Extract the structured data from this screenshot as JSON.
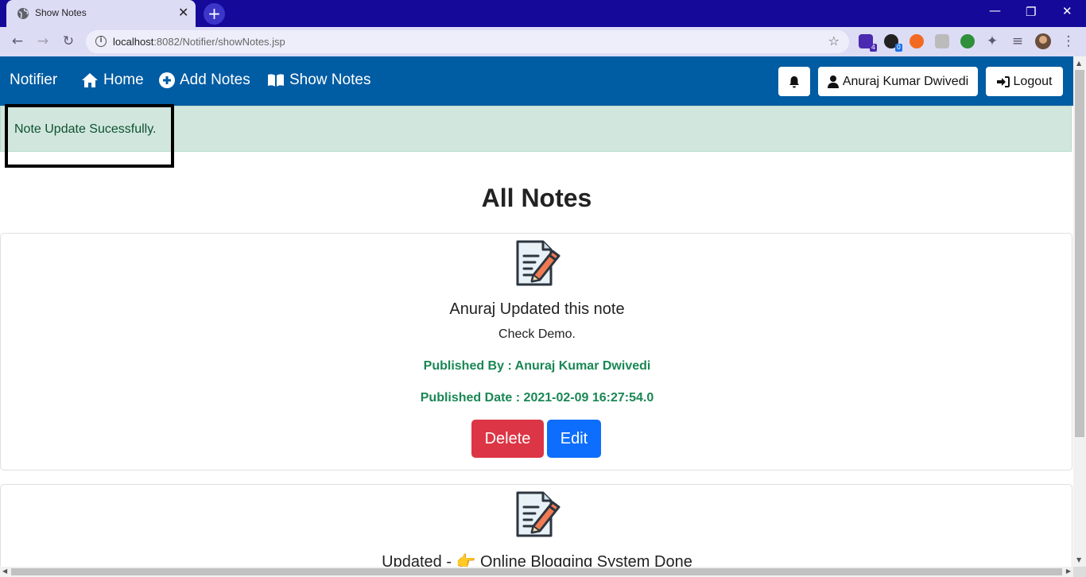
{
  "browser": {
    "tab_title": "Show Notes",
    "tab_close": "✕",
    "new_tab": "+",
    "url_host": "localhost",
    "url_path": ":8082/Notifier/showNotes.jsp",
    "extensions": [
      {
        "name": "extension-1",
        "badge": "4",
        "color": "#4a2ab0"
      },
      {
        "name": "extension-2",
        "badge": "0",
        "color": "#222222"
      },
      {
        "name": "extension-3",
        "badge": "",
        "color": "#f26a21"
      },
      {
        "name": "extension-4",
        "badge": "",
        "color": "#bbbbbb"
      },
      {
        "name": "extension-5",
        "badge": "",
        "color": "#2f8f3a"
      }
    ]
  },
  "navbar": {
    "brand": "Notifier",
    "home": "Home",
    "add_notes": "Add Notes",
    "show_notes": "Show Notes",
    "user": "Anuraj Kumar Dwivedi",
    "logout": "Logout"
  },
  "alert": {
    "message": "Note Update Sucessfully."
  },
  "heading": "All Notes",
  "notes": [
    {
      "title": "Anuraj Updated this note",
      "content": "Check Demo.",
      "published_by": "Published By : Anuraj Kumar Dwivedi",
      "published_date": "Published Date : 2021-02-09 16:27:54.0",
      "delete_label": "Delete",
      "edit_label": "Edit"
    },
    {
      "title": "Updated - 👉 Online Blogging System Done"
    }
  ],
  "colors": {
    "navbar": "#005ca3",
    "alert_bg": "#d1e7dd",
    "alert_text": "#0f5132",
    "meta_green": "#198754",
    "danger": "#dc3545",
    "primary": "#0d6efd"
  }
}
